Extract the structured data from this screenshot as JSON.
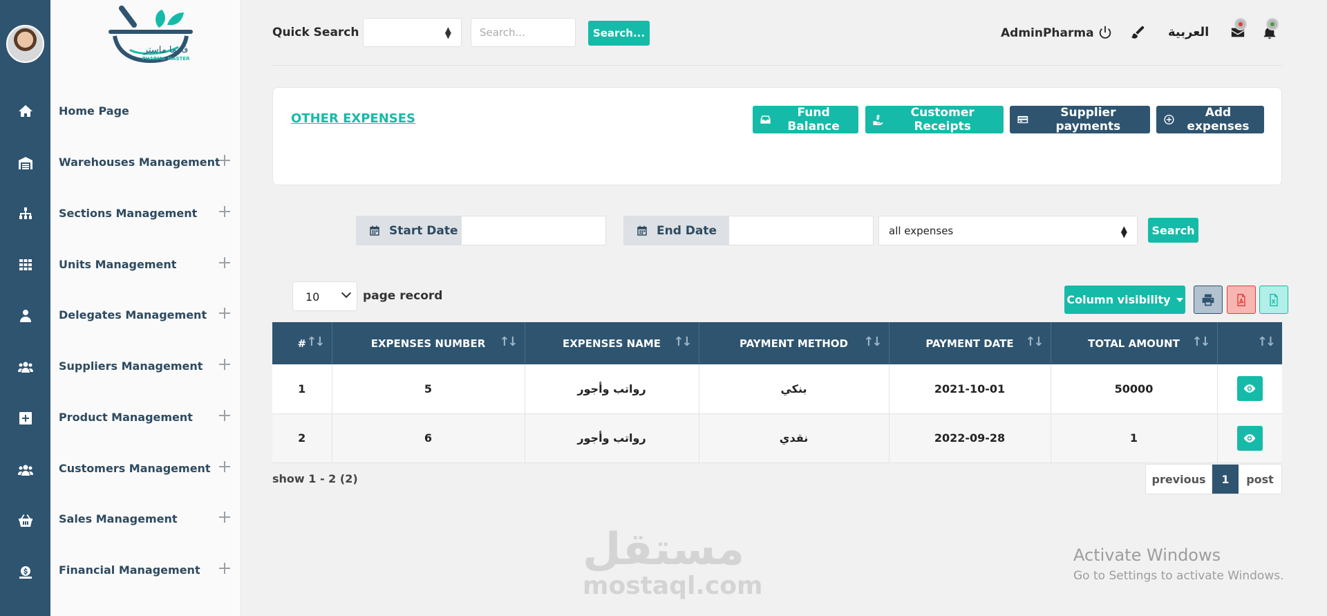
{
  "colors": {
    "rail": "#2e5470",
    "accent": "#15bba8",
    "navy": "#2e5470"
  },
  "logo": {
    "ar": "فارما ماستر",
    "en": "PHARMA MASTER"
  },
  "rail_icons": [
    "home-icon",
    "warehouse-icon",
    "sitemap-icon",
    "grid-icon",
    "user-icon",
    "users-icon",
    "plus-square-icon",
    "users-icon",
    "basket-icon",
    "money-icon"
  ],
  "sidebar": {
    "items": [
      {
        "label": "Home Page"
      },
      {
        "label": "Warehouses Management"
      },
      {
        "label": "Sections Management"
      },
      {
        "label": "Units Management"
      },
      {
        "label": "Delegates Management"
      },
      {
        "label": "Suppliers Management"
      },
      {
        "label": "Product Management"
      },
      {
        "label": "Customers Management"
      },
      {
        "label": "Sales Management"
      },
      {
        "label": "Financial Management"
      }
    ]
  },
  "topbar": {
    "quick_search_label": "Quick Search",
    "search_placeholder": "Search...",
    "search_button": "Search...",
    "user": "AdminPharma",
    "language": "العربية"
  },
  "header": {
    "title": "OTHER EXPENSES",
    "buttons": {
      "fund_balance": "Fund Balance",
      "customer_receipts": "Customer Receipts",
      "supplier_payments": "Supplier payments",
      "add_expenses": "Add expenses"
    }
  },
  "filters": {
    "start_date": "Start Date",
    "end_date": "End Date",
    "expense_type": "all expenses",
    "search": "Search"
  },
  "table_controls": {
    "records": "10",
    "records_label": "page record",
    "column_visibility": "Column visibility"
  },
  "table": {
    "headers": [
      "#",
      "EXPENSES NUMBER",
      "EXPENSES NAME",
      "PAYMENT METHOD",
      "PAYMENT DATE",
      "TOTAL AMOUNT",
      ""
    ],
    "rows": [
      [
        "1",
        "5",
        "رواتب وأجور",
        "بنكي",
        "2021-10-01",
        "50000"
      ],
      [
        "2",
        "6",
        "رواتب وأجور",
        "نقدي",
        "2022-09-28",
        "1"
      ]
    ]
  },
  "footer": {
    "show": "show 1 - 2 (2)",
    "previous": "previous",
    "current_page": "1",
    "next": "post"
  },
  "watermark": {
    "ar": "مستقل",
    "en": "mostaql.com"
  },
  "activate": {
    "title": "Activate Windows",
    "subtitle": "Go to Settings to activate Windows."
  }
}
